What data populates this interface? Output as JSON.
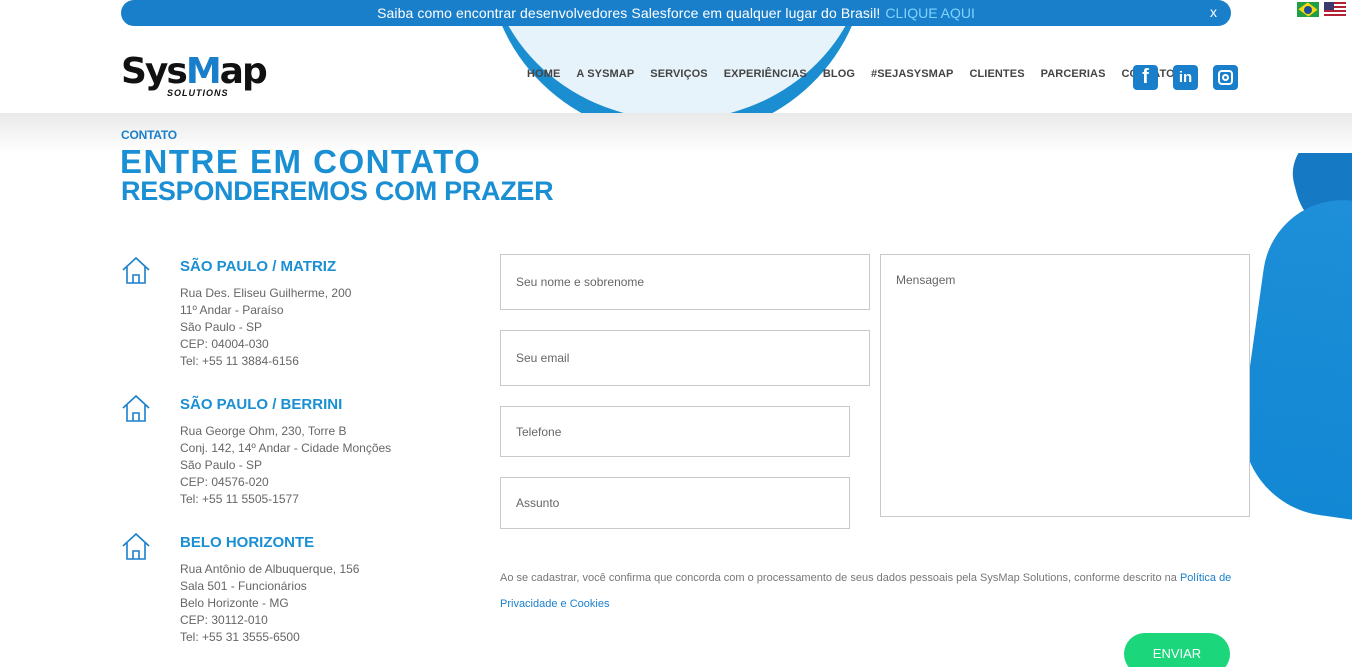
{
  "banner": {
    "text": "Saiba como encontrar desenvolvedores Salesforce em qualquer lugar do Brasil!",
    "link_text": "CLIQUE AQUI",
    "close_label": "x"
  },
  "language_flags": [
    "pt-br-flag-icon",
    "en-us-flag-icon"
  ],
  "logo": {
    "main_prefix": "Sys",
    "main_mark": "M",
    "main_suffix": "ap",
    "sub": "SOLUTIONS"
  },
  "nav": {
    "items": [
      "HOME",
      "A SYSMAP",
      "SERVIÇOS",
      "EXPERIÊNCIAS",
      "BLOG",
      "#SEJASYSMAP",
      "CLIENTES",
      "PARCERIAS",
      "CONTATO"
    ]
  },
  "social": {
    "facebook": "f",
    "linkedin": "in",
    "icons": [
      "facebook-icon",
      "linkedin-icon",
      "instagram-icon"
    ]
  },
  "section": {
    "kicker": "CONTATO",
    "title": "ENTRE EM CONTATO",
    "subtitle": "RESPONDEREMOS COM PRAZER"
  },
  "offices": [
    {
      "title": "SÃO PAULO / MATRIZ",
      "lines": [
        "Rua Des. Eliseu Guilherme, 200",
        "11º Andar - Paraíso",
        "São Paulo - SP",
        "CEP: 04004-030",
        "Tel: +55 11 3884-6156"
      ]
    },
    {
      "title": "SÃO PAULO / BERRINI",
      "lines": [
        "Rua George Ohm, 230, Torre B",
        "Conj. 142, 14º Andar - Cidade Monções",
        "São Paulo - SP",
        "CEP: 04576-020",
        "Tel: +55 11 5505-1577"
      ]
    },
    {
      "title": "BELO HORIZONTE",
      "lines": [
        "Rua Antônio de Albuquerque, 156",
        "Sala 501 - Funcionários",
        "Belo Horizonte - MG",
        "CEP: 30112-010",
        "Tel: +55 31 3555-6500"
      ]
    }
  ],
  "form": {
    "name_placeholder": "Seu nome e sobrenome",
    "email_placeholder": "Seu email",
    "phone_placeholder": "Telefone",
    "subject_placeholder": "Assunto",
    "message_placeholder": "Mensagem",
    "consent_text": "Ao se cadastrar, você confirma que concorda com o processamento de seus dados pessoais pela SysMap Solutions, conforme descrito na",
    "consent_link": "Política de Privacidade e Cookies",
    "submit_label": "ENVIAR"
  },
  "colors": {
    "brand_blue": "#1a8fd3",
    "banner_blue": "#1a7fcb",
    "link_cyan": "#7fd4ff",
    "submit_green": "#1bd67a"
  }
}
